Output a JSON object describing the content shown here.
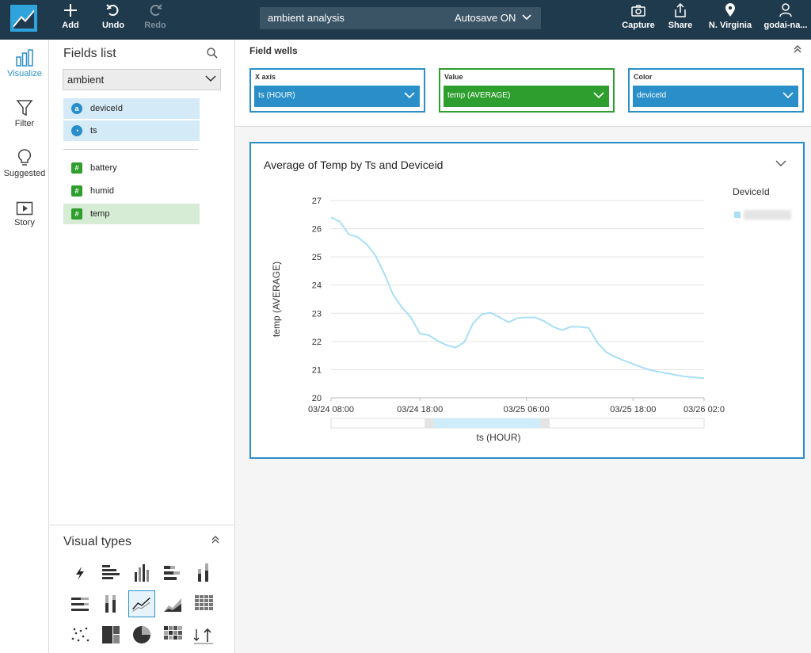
{
  "toolbar": {
    "add_label": "Add",
    "undo_label": "Undo",
    "redo_label": "Redo",
    "capture_label": "Capture",
    "share_label": "Share",
    "region_label": "N. Virginia",
    "user_label": "godai-na..."
  },
  "analysis": {
    "name": "ambient analysis",
    "autosave": "Autosave ON"
  },
  "rail": {
    "visualize": "Visualize",
    "filter": "Filter",
    "suggested": "Suggested",
    "story": "Story"
  },
  "fields_panel": {
    "title": "Fields list",
    "dataset": "ambient",
    "dimensions": [
      {
        "badge": "a",
        "name": "deviceId"
      },
      {
        "badge": "◔",
        "name": "ts"
      }
    ],
    "measures": [
      {
        "badge": "#",
        "name": "battery"
      },
      {
        "badge": "#",
        "name": "humid"
      },
      {
        "badge": "#",
        "name": "temp"
      }
    ]
  },
  "visual_types": {
    "title": "Visual types",
    "items": [
      "autograph-icon",
      "horizontal-bar-icon",
      "vertical-bar-icon",
      "horizontal-stacked-bar-icon",
      "vertical-stacked-bar-icon",
      "horizontal-percent-bar-icon",
      "vertical-percent-bar-icon",
      "line-chart-icon",
      "area-chart-icon",
      "pivot-table-icon",
      "scatter-plot-icon",
      "tree-map-icon",
      "pie-chart-icon",
      "heat-map-icon",
      "kpi-icon"
    ],
    "selected": "line-chart-icon"
  },
  "field_wells": {
    "title": "Field wells",
    "x_axis": {
      "label": "X axis",
      "value": "ts (HOUR)"
    },
    "value": {
      "label": "Value",
      "value": "temp (AVERAGE)"
    },
    "color": {
      "label": "Color",
      "value": "deviceId"
    }
  },
  "visual": {
    "title": "Average of Temp by Ts and Deviceid",
    "legend_title": "DeviceId"
  },
  "colors": {
    "topbar": "#1f3a4d",
    "accent_blue": "#2a8fc9",
    "accent_green": "#2e9e2e",
    "series": "#a8dff5"
  },
  "chart_data": {
    "type": "line",
    "title": "Average of Temp by Ts and Deviceid",
    "xlabel": "ts (HOUR)",
    "ylabel": "temp (AVERAGE)",
    "ylim": [
      20,
      27
    ],
    "yticks": [
      20,
      21,
      22,
      23,
      24,
      25,
      26,
      27
    ],
    "xlim_hours": [
      0,
      42
    ],
    "xticks": [
      {
        "hour": 0,
        "label": "03/24 08:00"
      },
      {
        "hour": 10,
        "label": "03/24 18:00"
      },
      {
        "hour": 22,
        "label": "03/25 06:00"
      },
      {
        "hour": 34,
        "label": "03/25 18:00"
      },
      {
        "hour": 42,
        "label": "03/26 02:0"
      }
    ],
    "legend_title": "DeviceId",
    "grid": true,
    "series": [
      {
        "x": [
          0,
          1,
          2,
          3,
          4,
          5,
          6,
          7,
          8,
          9,
          10,
          11,
          12,
          13,
          14,
          15,
          16,
          17,
          18,
          19,
          20,
          21,
          22,
          23,
          24,
          25,
          26,
          27,
          28,
          29,
          30,
          31,
          32,
          33,
          34,
          35,
          36,
          37,
          38,
          39,
          40,
          41,
          42
        ],
        "values": [
          26.4,
          26.25,
          25.8,
          25.7,
          25.45,
          25.05,
          24.4,
          23.65,
          23.2,
          22.85,
          22.28,
          22.22,
          22.02,
          21.87,
          21.78,
          21.97,
          22.65,
          22.97,
          23.02,
          22.85,
          22.68,
          22.83,
          22.85,
          22.85,
          22.72,
          22.52,
          22.4,
          22.52,
          22.52,
          22.48,
          21.95,
          21.62,
          21.45,
          21.32,
          21.2,
          21.08,
          20.98,
          20.92,
          20.86,
          20.8,
          20.75,
          20.72,
          20.7
        ]
      }
    ]
  }
}
